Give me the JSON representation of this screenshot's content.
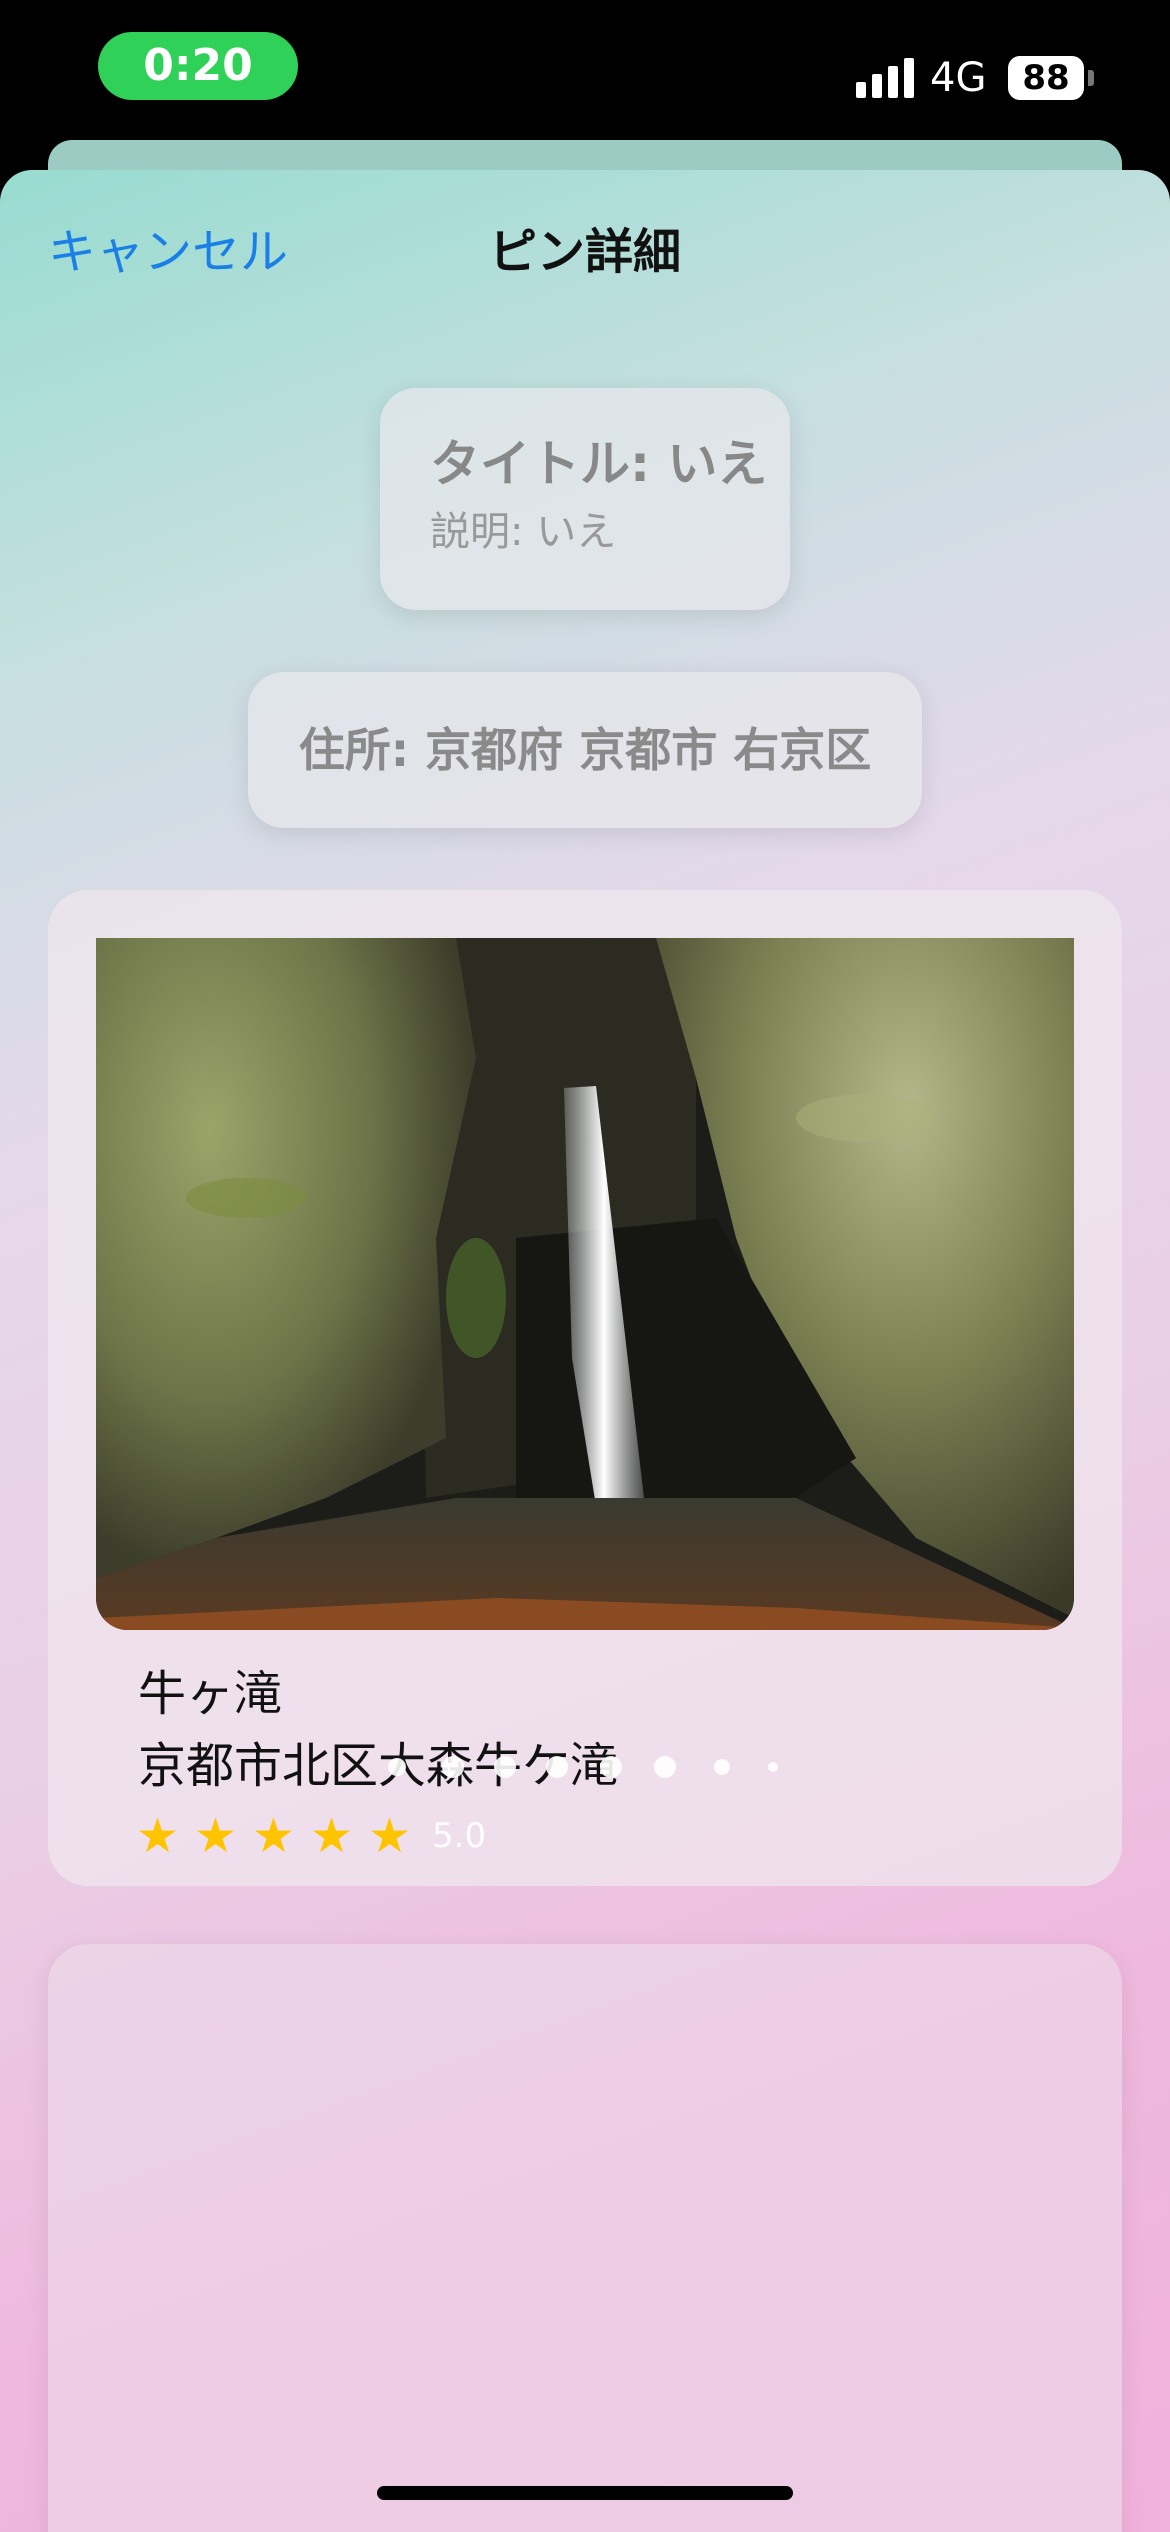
{
  "status_bar": {
    "time": "0:20",
    "network": "4G",
    "battery": "88",
    "signal_icon": "cellular-signal-icon",
    "battery_icon": "battery-icon"
  },
  "nav": {
    "cancel_label": "キャンセル",
    "title": "ピン詳細"
  },
  "pin": {
    "title_line": "タイトル: いえ",
    "description_line": "説明: いえ",
    "address_line": "住所: 京都府 京都市 右京区"
  },
  "place": {
    "name": "牛ヶ滝",
    "address": "京都市北区大森牛ケ滝",
    "rating": 5.0,
    "rating_label": "5.0",
    "stars": 5,
    "photo": "waterfall-photo",
    "page_indicator_count": 8
  },
  "colors": {
    "accent": "#1a7fe6",
    "time_pill": "#30d158",
    "star": "#ffc400"
  }
}
